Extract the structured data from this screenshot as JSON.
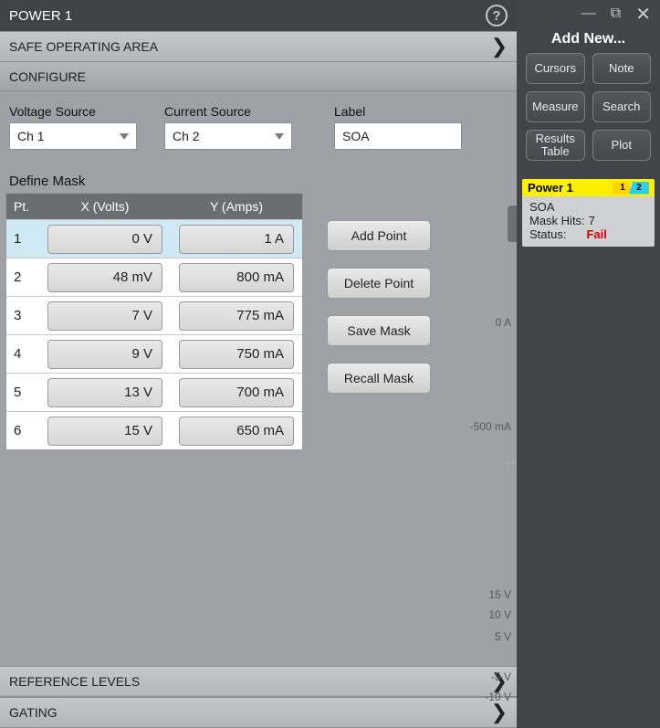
{
  "header": {
    "title": "POWER 1"
  },
  "sections": {
    "soa": "SAFE OPERATING AREA",
    "configure": "CONFIGURE",
    "reference": "REFERENCE LEVELS",
    "gating": "GATING"
  },
  "sources": {
    "voltage_label": "Voltage Source",
    "voltage_value": "Ch 1",
    "current_label": "Current Source",
    "current_value": "Ch 2",
    "label_label": "Label",
    "label_value": "SOA"
  },
  "mask": {
    "title": "Define Mask",
    "columns": {
      "pt": "Pt.",
      "x": "X (Volts)",
      "y": "Y (Amps)"
    },
    "rows": [
      {
        "pt": "1",
        "x": "0 V",
        "y": "1 A",
        "selected": true
      },
      {
        "pt": "2",
        "x": "48 mV",
        "y": "800 mA"
      },
      {
        "pt": "3",
        "x": "7 V",
        "y": "775 mA"
      },
      {
        "pt": "4",
        "x": "9 V",
        "y": "750 mA"
      },
      {
        "pt": "5",
        "x": "13 V",
        "y": "700 mA"
      },
      {
        "pt": "6",
        "x": "15 V",
        "y": "650 mA"
      }
    ],
    "buttons": {
      "add": "Add Point",
      "delete": "Delete Point",
      "save": "Save Mask",
      "recall": "Recall Mask"
    }
  },
  "yaxis_upper": [
    "0 A",
    "-500 mA"
  ],
  "yaxis_lower": [
    "15 V",
    "10 V",
    "5 V",
    "",
    "-5 V",
    "-10 V"
  ],
  "side": {
    "title": "Add New...",
    "buttons": {
      "cursors": "Cursors",
      "note": "Note",
      "measure": "Measure",
      "search": "Search",
      "results": "Results Table",
      "plot": "Plot"
    },
    "result": {
      "name": "Power 1",
      "badge1": "1",
      "badge2": "2",
      "soa_label": "SOA",
      "hits_label": "Mask Hits:",
      "hits_value": "7",
      "status_label": "Status:",
      "status_value": "Fail"
    }
  }
}
